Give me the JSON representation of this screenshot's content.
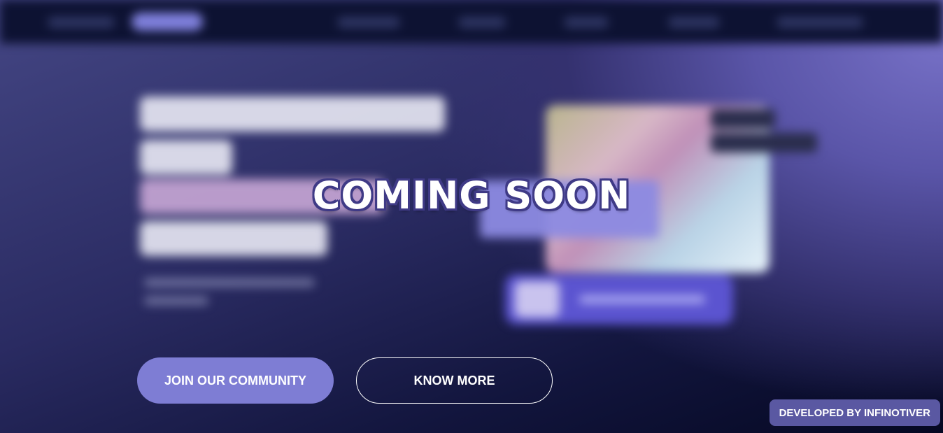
{
  "overlay": {
    "title": "COMING SOON"
  },
  "buttons": {
    "join_label": "JOIN OUR COMMUNITY",
    "know_more_label": "KNOW MORE"
  },
  "footer_badge": {
    "label": "DEVELOPED BY INFINOTIVER"
  },
  "colors": {
    "primary_button": "#7e7dd4",
    "badge": "#5a58a2",
    "title_outline": "#3f3a86"
  }
}
